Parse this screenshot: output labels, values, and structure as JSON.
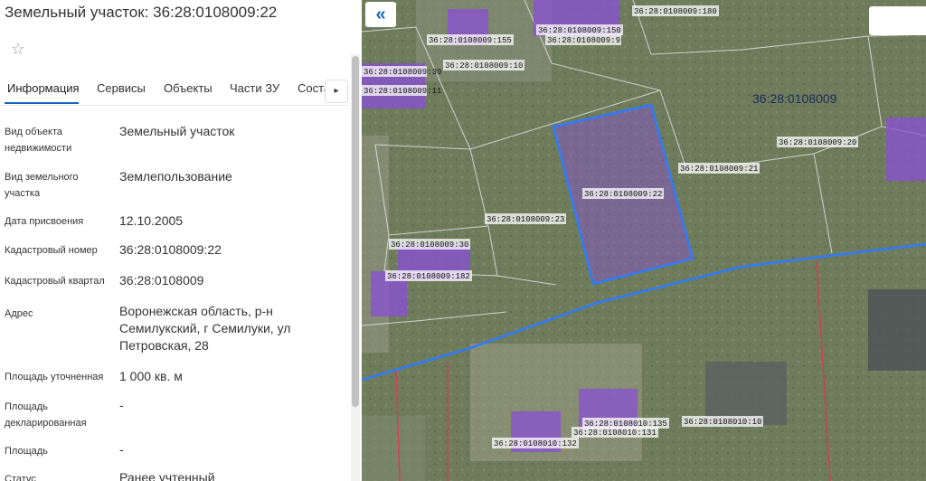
{
  "panel": {
    "title": "Земельный участок: 36:28:0108009:22",
    "tabs": [
      "Информация",
      "Сервисы",
      "Объекты",
      "Части ЗУ",
      "Соста"
    ],
    "tab_scroll_glyph": "▸",
    "rows": [
      {
        "label": "Вид объекта недвижимости",
        "value": "Земельный участок"
      },
      {
        "label": "Вид земельного участка",
        "value": "Землепользование"
      },
      {
        "label": "Дата присвоения",
        "value": "12.10.2005"
      },
      {
        "label": "Кадастровый номер",
        "value": "36:28:0108009:22"
      },
      {
        "label": "Кадастровый квартал",
        "value": "36:28:0108009"
      },
      {
        "label": "Адрес",
        "value": "Воронежская область, р-н Семилукский, г Семилуки, ул Петровская, 28"
      },
      {
        "label": "Площадь уточненная",
        "value": "1 000 кв. м"
      },
      {
        "label": "Площадь декларированная",
        "value": "-"
      },
      {
        "label": "Площадь",
        "value": "-"
      },
      {
        "label": "Статус",
        "value": "Ранее учтенный"
      }
    ]
  },
  "map": {
    "collapse_glyph": "«",
    "quarter_label": "36:28:0108009",
    "parcel_labels": [
      "36:28:0108009:180",
      "36:28:0108009:155",
      "36:28:0108009:150",
      "36:28:0108009:9",
      "36:28:0108009:10",
      "36:28:0108009:39",
      "36:28:0108009:11",
      "36:28:0108009:20",
      "36:28:0108009:21",
      "36:28:0108009:22",
      "36:28:0108009:23",
      "36:28:0108009:30",
      "36:28:0108009:182",
      "36:28:0108010:135",
      "36:28:0108010:131",
      "36:28:0108010:132",
      "36:28:0108010:10"
    ],
    "colors": {
      "selected_outline": "#2f7bff",
      "parcel_fill": "#8a4fd6",
      "boundary_red": "#d04050"
    }
  }
}
